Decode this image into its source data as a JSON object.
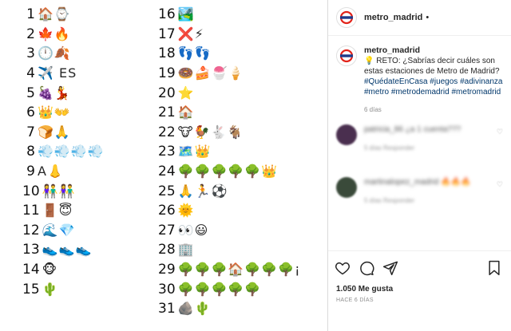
{
  "post": {
    "rows_left": [
      {
        "n": "1",
        "e": "🏠⌚"
      },
      {
        "n": "2",
        "e": "🍁🔥"
      },
      {
        "n": "3",
        "e": "🕛🍂"
      },
      {
        "n": "4",
        "e": "✈️ ES"
      },
      {
        "n": "5",
        "e": "🍇💃"
      },
      {
        "n": "6",
        "e": "👑👐"
      },
      {
        "n": "7",
        "e": "🍞🙏"
      },
      {
        "n": "8",
        "e": "💨💨💨💨"
      },
      {
        "n": "9",
        "e": "A👃"
      },
      {
        "n": "10",
        "e": "👫👫"
      },
      {
        "n": "11",
        "e": "🚪😇"
      },
      {
        "n": "12",
        "e": "🌊💎"
      },
      {
        "n": "13",
        "e": "👟👟👟"
      },
      {
        "n": "14",
        "e": "🐵"
      },
      {
        "n": "15",
        "e": "🌵"
      }
    ],
    "rows_right": [
      {
        "n": "16",
        "e": "🏞️"
      },
      {
        "n": "17",
        "e": "❌⚡"
      },
      {
        "n": "18",
        "e": "👣👣"
      },
      {
        "n": "19",
        "e": "🍩🍰🍧🍦"
      },
      {
        "n": "20",
        "e": "⭐"
      },
      {
        "n": "21",
        "e": "🏠"
      },
      {
        "n": "22",
        "e": "🐮🐓🐇🐐"
      },
      {
        "n": "23",
        "e": "🗺️👑"
      },
      {
        "n": "24",
        "e": "🌳🌳🌳🌳🌳👑"
      },
      {
        "n": "25",
        "e": "🙏🏃⚽"
      },
      {
        "n": "26",
        "e": "🌞"
      },
      {
        "n": "27",
        "e": "👀😃"
      },
      {
        "n": "28",
        "e": "🏢"
      },
      {
        "n": "29",
        "e": "🌳🌳🌳🏠🌳🌳🌳¡"
      },
      {
        "n": "30",
        "e": "🌳🌳🌳🌳🌳"
      },
      {
        "n": "31",
        "e": "🪨🌵"
      }
    ]
  },
  "header": {
    "username": "metro_madrid",
    "dot": "•"
  },
  "caption": {
    "username": "metro_madrid",
    "text": "💡 RETO: ¿Sabrías decir cuáles son estas estaciones de Metro de Madrid?",
    "hashtags": "#QuédateEnCasa #juegos #adivinanza #metro #metrodemadrid #metromadrid",
    "ago": "6 días"
  },
  "comments": [
    {
      "text": "patricia_86 ¿a 1 cuenta???",
      "meta": "5 días   Responder",
      "avatar": "#4a2f4f"
    },
    {
      "text": "martinalopez_madrid 🔥🔥🔥",
      "meta": "5 días   Responder",
      "avatar": "#3a4a3a"
    }
  ],
  "likes": "1.050 Me gusta",
  "when": "HACE 6 DÍAS",
  "colors": {
    "brand_red": "#e2231a",
    "brand_blue": "#1e3a8a",
    "link": "#00376b"
  }
}
